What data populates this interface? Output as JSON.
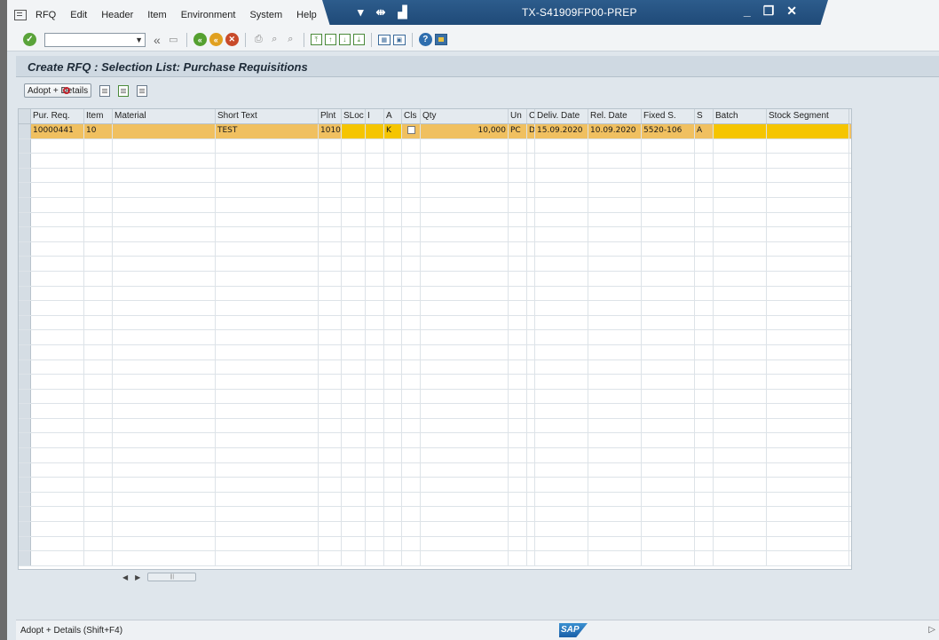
{
  "menubar": {
    "items": [
      "RFQ",
      "Edit",
      "Header",
      "Item",
      "Environment",
      "System",
      "Help"
    ]
  },
  "titlebar": {
    "title": "TX-S41909FP00-PREP"
  },
  "screen": {
    "title": "Create RFQ : Selection List: Purchase Requisitions"
  },
  "apptoolbar": {
    "adopt_details_label": "Adopt + Details"
  },
  "table": {
    "columns": [
      "Pur. Req.",
      "Item",
      "Material",
      "Short Text",
      "Plnt",
      "SLoc",
      "I",
      "A",
      "Cls",
      "Qty",
      "Un",
      "C",
      "Deliv. Date",
      "Rel. Date",
      "Fixed S.",
      "S",
      "Batch",
      "Stock Segment"
    ],
    "rows": [
      {
        "pur_req": "10000441",
        "item": "10",
        "material": "",
        "short_text": "TEST",
        "plnt": "1010",
        "sloc": "",
        "i": "",
        "a": "K",
        "qty": "10,000",
        "un": "PC",
        "c": "D",
        "deliv_date": "15.09.2020",
        "rel_date": "10.09.2020",
        "fixed_s": "5520-106",
        "s": "A",
        "batch": "",
        "stock_segment": ""
      }
    ]
  },
  "statusbar": {
    "text": "Adopt + Details   (Shift+F4)",
    "logo": "SAP"
  }
}
